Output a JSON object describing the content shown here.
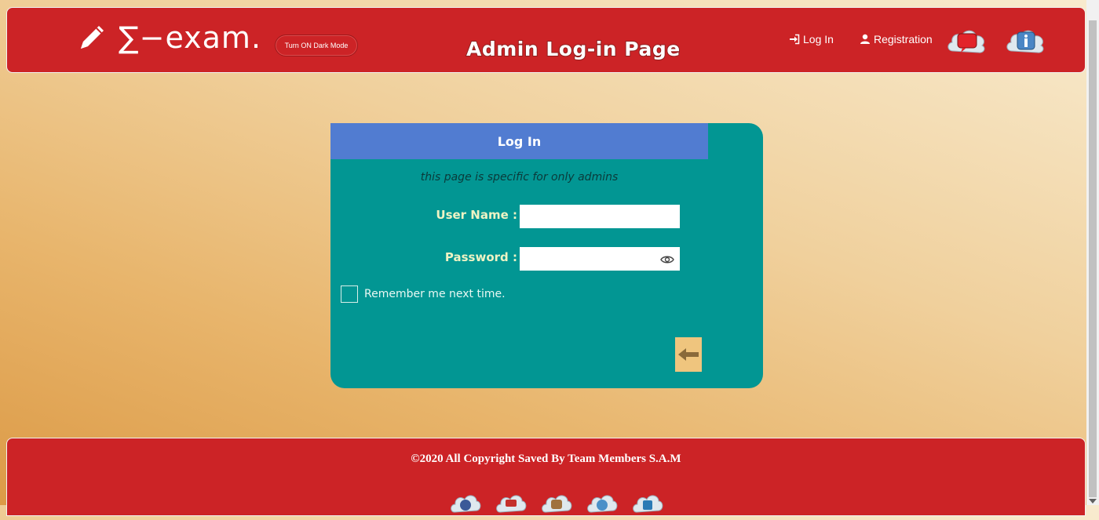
{
  "header": {
    "brand": "∑−exam.",
    "dark_mode_label": "Turn ON Dark Mode",
    "page_title": "Admin Log-in Page",
    "nav": [
      {
        "label": "Log In",
        "icon": "login-icon"
      },
      {
        "label": "Registration",
        "icon": "user-icon"
      }
    ],
    "icons": [
      "chat-cloud-icon",
      "info-cloud-icon"
    ]
  },
  "login": {
    "heading": "Log In",
    "subtitle": "this page is specific for only admins",
    "username_label": "User Name :",
    "username_value": "",
    "password_label": "Password :",
    "password_value": "",
    "remember_label": "Remember me next time.",
    "submit_icon": "arrow-left-icon"
  },
  "footer": {
    "copyright": "©2020 All Copyright Saved By Team Members S.A.M",
    "socials": [
      "facebook-icon",
      "youtube-icon",
      "instagram-icon",
      "twitter-icon",
      "linkedin-icon"
    ]
  },
  "colors": {
    "header_bg": "#cc2326",
    "card_bg": "#029693",
    "card_head_bg": "#517cd1",
    "submit_bg": "#efc57e"
  }
}
